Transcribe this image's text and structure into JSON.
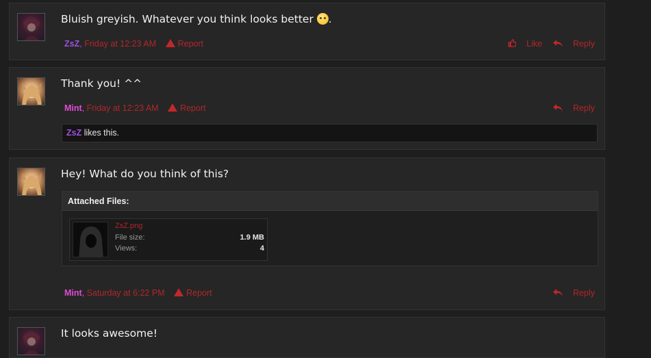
{
  "posts": [
    {
      "message": "Bluish greyish. Whatever you think looks better",
      "message_end": ".",
      "author": "ZsZ",
      "time": "Friday at 12:23 AM",
      "report": "Report",
      "like": "Like",
      "reply": "Reply"
    },
    {
      "message": "Thank you! ^^",
      "author": "Mint",
      "time": "Friday at 12:23 AM",
      "report": "Report",
      "reply": "Reply",
      "likes_user": "ZsZ",
      "likes_text": " likes this."
    },
    {
      "message": "Hey! What do you think of this?",
      "author": "Mint",
      "time": "Saturday at 6:22 PM",
      "report": "Report",
      "reply": "Reply",
      "attachments_title": "Attached Files:",
      "file": {
        "name": "ZsZ.png",
        "size_label": "File size:",
        "size": "1.9 MB",
        "views_label": "Views:",
        "views": "4"
      }
    },
    {
      "message": "It looks awesome!"
    }
  ],
  "colors": {
    "accent_red": "#b1262b",
    "user_purple": "#a04fe0",
    "user_pink": "#e24bd4",
    "post_bg": "#262626"
  },
  "icons": [
    "emoji-smile-icon",
    "warning-icon",
    "thumbs-up-icon",
    "reply-arrow-icon",
    "hooded-figure-thumbnail"
  ]
}
